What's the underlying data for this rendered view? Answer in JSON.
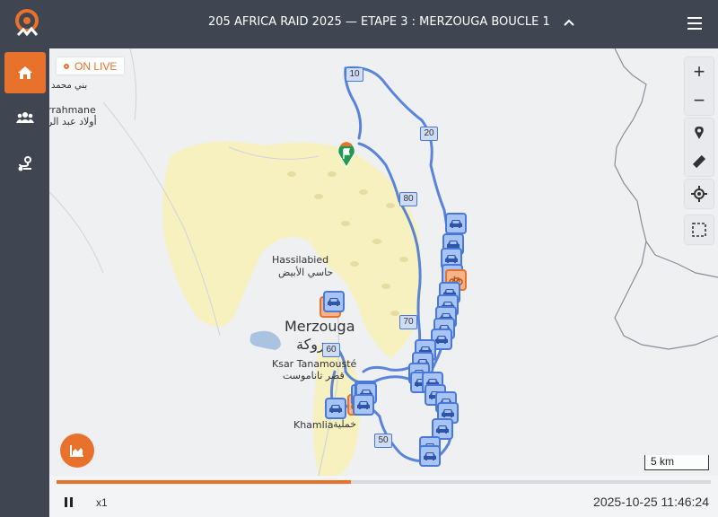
{
  "header": {
    "title": "205 AFRICA RAID 2025 — ETAPE 3 : MERZOUGA BOUCLE 1"
  },
  "sidebar": {
    "items": [
      {
        "icon": "home-icon",
        "active": true
      },
      {
        "icon": "users-icon",
        "active": false
      },
      {
        "icon": "route-icon",
        "active": false
      }
    ]
  },
  "map": {
    "live_label": "ON LIVE",
    "places": [
      {
        "name": "بني محمد"
      },
      {
        "name": "rrahmane أولاد عبد الر"
      },
      {
        "name": "Hassilabied"
      },
      {
        "name": "حاسي الأبيض"
      },
      {
        "name": "Merzouga"
      },
      {
        "name": "مرزوكة"
      },
      {
        "name": "Ksar Tanamousté"
      },
      {
        "name": "قصر تاناموست"
      },
      {
        "name": "Khamlia"
      },
      {
        "name": "خملية"
      }
    ],
    "km_markers": [
      "10",
      "20",
      "80",
      "70",
      "60",
      "50"
    ],
    "scale": "5 km",
    "controls": [
      "zoom-in-icon",
      "zoom-out-icon",
      "pin-icon",
      "ruler-icon",
      "locate-icon",
      "select-area-icon"
    ]
  },
  "playback": {
    "progress": 0.45,
    "speed": "x1",
    "timestamp": "2025-10-25 11:46:24"
  },
  "colors": {
    "accent": "#e8712b",
    "route": "#4a78d8",
    "header": "#3f4651"
  }
}
